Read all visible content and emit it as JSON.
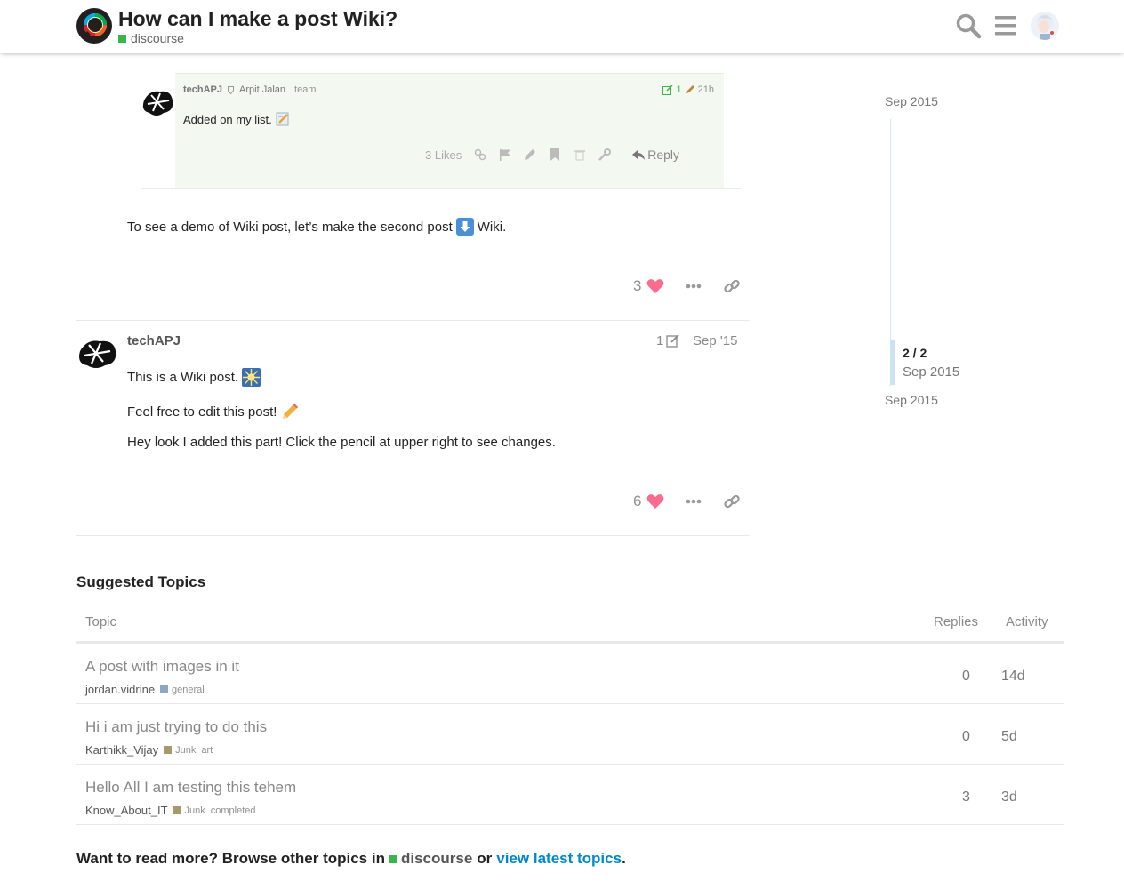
{
  "colors": {
    "accent_link": "#0088cc",
    "heart": "#fa6c8d",
    "category_discourse": "#3ab54a",
    "category_general": "#8ca9c2",
    "category_junk": "#a8996b"
  },
  "header": {
    "title": "How can I make a post Wiki?",
    "category": "discourse",
    "icons": [
      "search-icon",
      "hamburger-menu-icon",
      "user-avatar"
    ]
  },
  "quoted_post": {
    "username": "techAPJ",
    "full_name": "Arpit Jalan",
    "group": "team",
    "edits": "1",
    "age": "21h",
    "body": "Added on my list.",
    "likes": "3 Likes",
    "reply": "Reply"
  },
  "post1": {
    "text_before": "To see a demo of Wiki post, let’s make the second post",
    "text_after": "Wiki.",
    "likes": "3"
  },
  "post2": {
    "username": "techAPJ",
    "edits": "1",
    "date": "Sep '15",
    "line1": "This is a Wiki post.",
    "line2": "Feel free to edit this post!",
    "line3": "Hey look I added this part! Click the pencil at upper right to see changes.",
    "likes": "6"
  },
  "timeline": {
    "start": "Sep 2015",
    "position": "2 / 2",
    "position_date": "Sep 2015",
    "end": "Sep 2015"
  },
  "suggested": {
    "title": "Suggested Topics",
    "col_topic": "Topic",
    "col_replies": "Replies",
    "col_activity": "Activity",
    "rows": [
      {
        "title": "A post with images in it",
        "author": "jordan.vidrine",
        "category": "general",
        "tags": "",
        "replies": "0",
        "activity": "14d"
      },
      {
        "title": "Hi i am just trying to do this",
        "author": "Karthikk_Vijay",
        "category": "Junk",
        "tags": "art",
        "replies": "0",
        "activity": "5d"
      },
      {
        "title": "Hello All I am testing this tehem",
        "author": "Know_About_IT",
        "category": "Junk",
        "tags": "completed",
        "replies": "3",
        "activity": "3d"
      }
    ]
  },
  "footer": {
    "prefix": "Want to read more? Browse other topics in",
    "category": "discourse",
    "or": "or",
    "link": "view latest topics",
    "period": "."
  }
}
